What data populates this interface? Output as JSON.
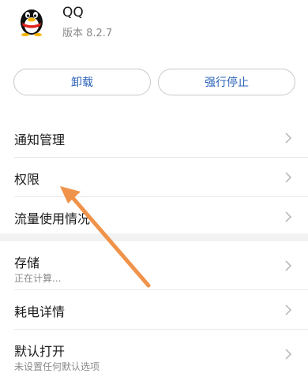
{
  "app": {
    "name": "QQ",
    "version": "版本 8.2.7",
    "icon": "qq-penguin-icon"
  },
  "actions": {
    "uninstall_label": "卸载",
    "force_stop_label": "强行停止"
  },
  "section1": [
    {
      "label": "通知管理"
    },
    {
      "label": "权限"
    },
    {
      "label": "流量使用情况"
    }
  ],
  "section2": [
    {
      "label": "存储",
      "sub": "正在计算..."
    },
    {
      "label": "耗电详情"
    },
    {
      "label": "默认打开",
      "sub": "未设置任何默认选项"
    }
  ],
  "colors": {
    "accent": "#2b63b8",
    "annotation_arrow": "#f0934a"
  }
}
